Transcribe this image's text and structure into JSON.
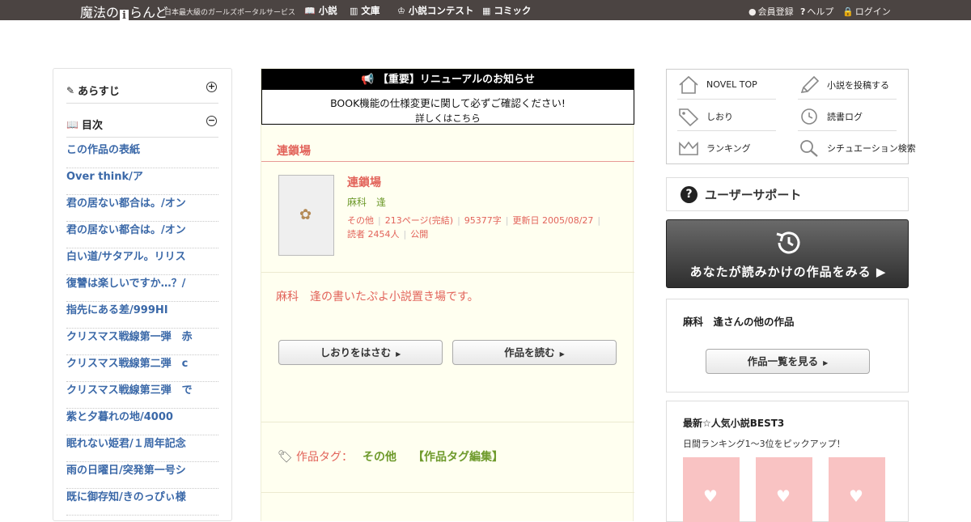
{
  "topbar": {
    "logo_prefix": "魔法の",
    "logo_i": "i",
    "logo_suffix": "らんど",
    "tagline": "日本最大級のガールズポータルサービス",
    "nav": [
      "小説",
      "文庫",
      "小説コンテスト",
      "コミック"
    ],
    "user": [
      "会員登録",
      "ヘルプ",
      "ログイン"
    ]
  },
  "sidebar": {
    "summary_label": "あらすじ",
    "toc_label": "目次",
    "toc_items": [
      "この作品の表紙",
      "Over think/ア",
      "君の居ない都合は。/オン",
      "君の居ない都合は。/オン",
      "白い道/サタアル。リリス",
      "復讐は楽しいですか…？/",
      "指先にある差/999HI",
      "クリスマス戦線第一弾　赤",
      "クリスマス戦線第二弾　c",
      "クリスマス戦線第三弾　で",
      "紫と夕暮れの地/4000",
      "眠れない姫君/１周年記念",
      "雨の日曜日/突発第一号シ",
      "既に御存知/きのっぴぃ様"
    ]
  },
  "notice": {
    "title": "【重要】リニューアルのお知らせ",
    "line1": "BOOK機能の仕様変更に関して必ずご確認ください!",
    "line2": "詳しくはこちら"
  },
  "work": {
    "section_title": "連鎖場",
    "title": "連鎖場",
    "author": "麻科　逢",
    "meta": [
      "その他",
      "213ページ(完結)",
      "95377字",
      "更新日 2005/08/27",
      "読者 2454人",
      "公開"
    ],
    "description": "麻科　逢の書いたぷよ小説置き場です。",
    "bookmark_button": "しおりをはさむ",
    "read_button": "作品を読む",
    "tag_label": "作品タグ：",
    "tag_value": "その他",
    "tag_edit": "【作品タグ編集】"
  },
  "menu": {
    "items": [
      "NOVEL TOP",
      "小説を投稿する",
      "しおり",
      "読書ログ",
      "ランキング",
      "シチュエーション検索"
    ]
  },
  "support_label": "ユーザーサポート",
  "history_label": "あなたが読みかけの作品をみる ▶",
  "others": {
    "title": "麻科　逢さんの他の作品",
    "button": "作品一覧を見る"
  },
  "best": {
    "title": "最新☆人気小説BEST3",
    "subtitle": "日間ランキング1～3位をピックアップ！"
  }
}
